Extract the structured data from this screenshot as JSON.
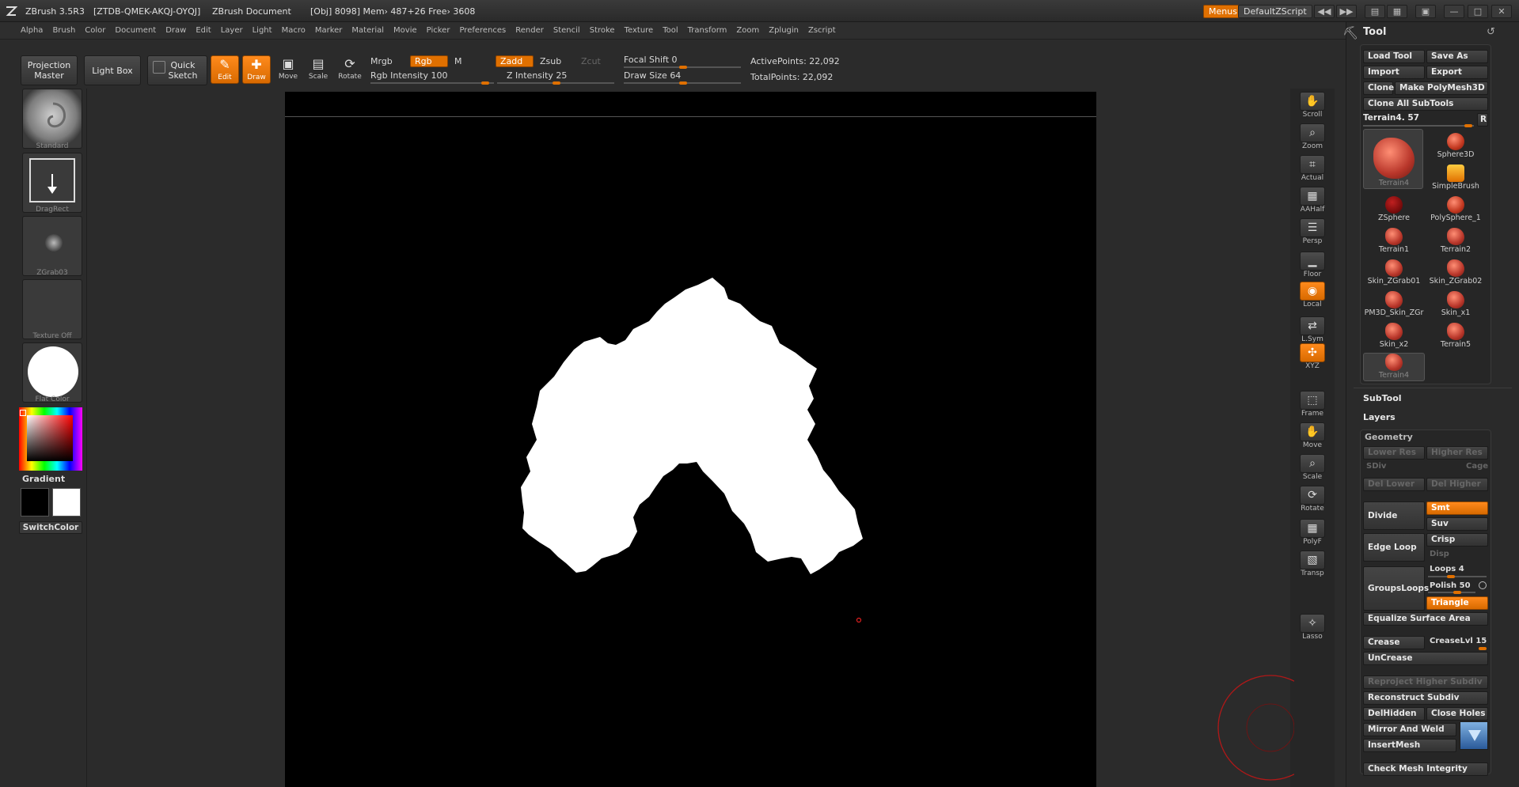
{
  "titlebar": {
    "app": "ZBrush 3.5R3",
    "serial": "[ZTDB-QMEK-AKQJ-OYQJ]",
    "doc": "ZBrush Document",
    "mem": "[Obj] 8098] Mem› 487+26 Free› 3608",
    "menus_btn": "Menus",
    "script_btn": "DefaultZScript"
  },
  "menubar": {
    "items": [
      "Alpha",
      "Brush",
      "Color",
      "Document",
      "Draw",
      "Edit",
      "Layer",
      "Light",
      "Macro",
      "Marker",
      "Material",
      "Movie",
      "Picker",
      "Preferences",
      "Render",
      "Stencil",
      "Stroke",
      "Texture",
      "Tool",
      "Transform",
      "Zoom",
      "Zplugin",
      "Zscript"
    ]
  },
  "toolbar": {
    "projection_master": "Projection Master",
    "light_box": "Light Box",
    "quick_sketch": "Quick Sketch",
    "edit": "Edit",
    "draw": "Draw",
    "move": "Move",
    "scale": "Scale",
    "rotate": "Rotate",
    "mrgb": "Mrgb",
    "rgb": "Rgb",
    "m": "M",
    "zadd": "Zadd",
    "zsub": "Zsub",
    "zcut": "Zcut",
    "rgb_intensity_label": "Rgb Intensity",
    "rgb_intensity": "100",
    "z_intensity_label": "Z Intensity",
    "z_intensity": "25",
    "focal_shift_label": "Focal Shift",
    "focal_shift": "0",
    "draw_size_label": "Draw Size",
    "draw_size": "64",
    "active_points": "ActivePoints: 22,092",
    "total_points": "TotalPoints: 22,092"
  },
  "leftshelf": {
    "brush": "Standard",
    "stroke": "DragRect",
    "alpha": "ZGrab03",
    "texture": "Texture Off",
    "material": "Flat Color",
    "gradient": "Gradient",
    "switchcolor": "SwitchColor"
  },
  "rightshelf": [
    "Scroll",
    "Zoom",
    "Actual",
    "AAHalf",
    "Persp",
    "Floor",
    "Local",
    "L.Sym",
    "XYZ",
    "Frame",
    "Move",
    "Scale",
    "Rotate",
    "PolyF",
    "Transp",
    "Lasso"
  ],
  "toolpanel": {
    "title": "Tool",
    "load_tool": "Load Tool",
    "save_as": "Save As",
    "import": "Import",
    "export": "Export",
    "clone": "Clone",
    "make_polymesh": "Make PolyMesh3D",
    "clone_all": "Clone All SubTools",
    "current_tool": "Terrain4. 57",
    "r_btn": "R",
    "tools": [
      {
        "name": "Terrain4"
      },
      {
        "name": "Sphere3D"
      },
      {
        "name": "SimpleBrush"
      },
      {
        "name": "ZSphere"
      },
      {
        "name": "PolySphere_1"
      },
      {
        "name": "Terrain1"
      },
      {
        "name": "Terrain2"
      },
      {
        "name": "Skin_ZGrab01"
      },
      {
        "name": "Skin_ZGrab02"
      },
      {
        "name": "PM3D_Skin_ZGr"
      },
      {
        "name": "Skin_x1"
      },
      {
        "name": "Skin_x2"
      },
      {
        "name": "Terrain5"
      },
      {
        "name": "Terrain4"
      }
    ],
    "subtool": "SubTool",
    "layers": "Layers",
    "geometry": "Geometry",
    "lower_res": "Lower Res",
    "higher_res": "Higher Res",
    "sdiv": "SDiv",
    "cage": "Cage",
    "del_lower": "Del Lower",
    "del_higher": "Del Higher",
    "divide": "Divide",
    "smt": "Smt",
    "suv": "Suv",
    "edge_loop": "Edge Loop",
    "crisp": "Crisp",
    "disp": "Disp",
    "groups_loops": "GroupsLoops",
    "loops": "Loops 4",
    "polish": "Polish 50",
    "triangle": "Triangle",
    "equalize": "Equalize Surface Area",
    "crease": "Crease",
    "crease_lvl": "CreaseLvl 15",
    "uncrease": "UnCrease",
    "reproject": "Reproject Higher Subdiv",
    "reconstruct": "Reconstruct Subdiv",
    "del_hidden": "DelHidden",
    "close_holes": "Close Holes",
    "mirror_weld": "Mirror And Weld",
    "insert_mesh": "InsertMesh",
    "check_mesh": "Check Mesh Integrity"
  },
  "colors": {
    "accent": "#e07000",
    "canvas": "#000000",
    "panel": "#2a2a2a"
  }
}
